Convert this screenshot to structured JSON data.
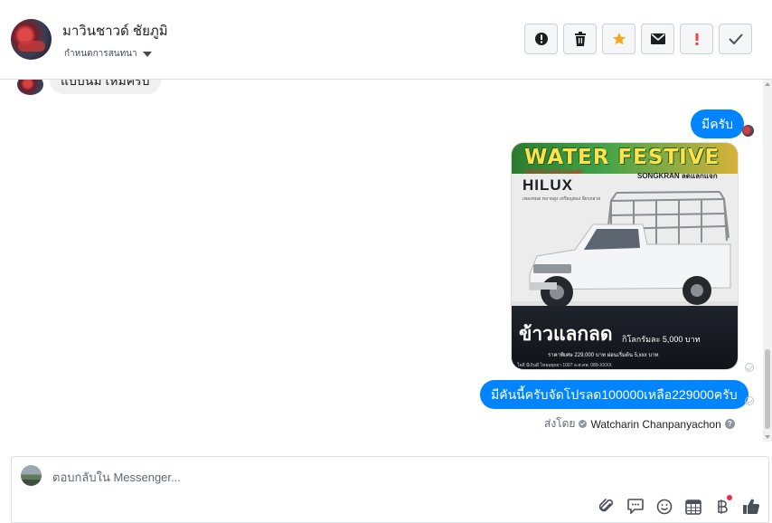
{
  "header": {
    "contact_name": "มาวินชาวด์ ชัยภูมิ",
    "subtitle": "กำหนดการสนทนา"
  },
  "actions": [
    {
      "name": "report-button",
      "icon": "alert-circle-icon"
    },
    {
      "name": "delete-button",
      "icon": "trash-icon"
    },
    {
      "name": "star-button",
      "icon": "star-icon",
      "color": "#f5a623"
    },
    {
      "name": "mark-unread-button",
      "icon": "envelope-icon"
    },
    {
      "name": "important-button",
      "icon": "exclamation-icon",
      "color": "#fa3e3e"
    },
    {
      "name": "done-button",
      "icon": "check-icon"
    }
  ],
  "conversation": {
    "incoming_partial": "แบบนม เหมครบ",
    "outgoing": [
      {
        "text": "มีครับ"
      },
      {
        "text": "มีคันนี้ครับจัดโปรลด100000เหลือ229000ครับ"
      }
    ],
    "image": {
      "title": "WATER FESTIVE",
      "songkran": "SONGKRAN ลดแลกแจก",
      "model_small": "TOYOTA VIGO CHAMP",
      "model": "HILUX",
      "tagline": "เพลงหมด หลายสูง เหรียญทอง ลียรถสวย",
      "headline": "ข้าวแลกลด",
      "price_line": "กิโลกรัมละ 5,000 บาท",
      "line2": "ราคาพิเศษ 229,000 บาท ผ่อนเริ่มต้น 5,xxx บาท",
      "footer": "ใจดี มีเงินดี ไทยอยุธยา 1007 ล.ศ.คพ. 089-XXXX"
    },
    "sent_by_label": "ส่งโดย",
    "sent_by_name": "Watcharin Chanpanyachon"
  },
  "composer": {
    "placeholder": "ตอบกลับใน Messenger..."
  },
  "colors": {
    "bubble_out": "#0084ff",
    "bubble_in": "#f1f0f0",
    "like": "#4b4f56"
  }
}
